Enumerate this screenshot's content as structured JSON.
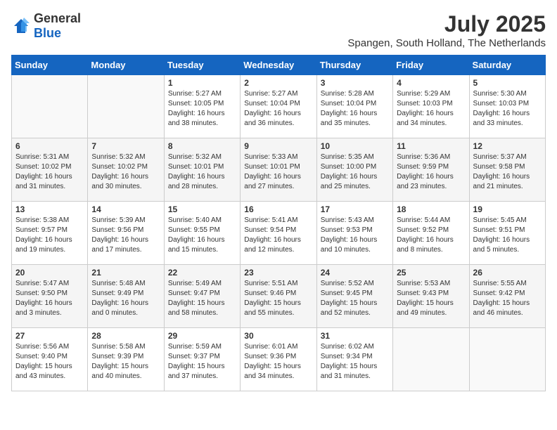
{
  "logo": {
    "general": "General",
    "blue": "Blue"
  },
  "header": {
    "month": "July 2025",
    "location": "Spangen, South Holland, The Netherlands"
  },
  "weekdays": [
    "Sunday",
    "Monday",
    "Tuesday",
    "Wednesday",
    "Thursday",
    "Friday",
    "Saturday"
  ],
  "weeks": [
    [
      {
        "day": "",
        "info": ""
      },
      {
        "day": "",
        "info": ""
      },
      {
        "day": "1",
        "info": "Sunrise: 5:27 AM\nSunset: 10:05 PM\nDaylight: 16 hours\nand 38 minutes."
      },
      {
        "day": "2",
        "info": "Sunrise: 5:27 AM\nSunset: 10:04 PM\nDaylight: 16 hours\nand 36 minutes."
      },
      {
        "day": "3",
        "info": "Sunrise: 5:28 AM\nSunset: 10:04 PM\nDaylight: 16 hours\nand 35 minutes."
      },
      {
        "day": "4",
        "info": "Sunrise: 5:29 AM\nSunset: 10:03 PM\nDaylight: 16 hours\nand 34 minutes."
      },
      {
        "day": "5",
        "info": "Sunrise: 5:30 AM\nSunset: 10:03 PM\nDaylight: 16 hours\nand 33 minutes."
      }
    ],
    [
      {
        "day": "6",
        "info": "Sunrise: 5:31 AM\nSunset: 10:02 PM\nDaylight: 16 hours\nand 31 minutes."
      },
      {
        "day": "7",
        "info": "Sunrise: 5:32 AM\nSunset: 10:02 PM\nDaylight: 16 hours\nand 30 minutes."
      },
      {
        "day": "8",
        "info": "Sunrise: 5:32 AM\nSunset: 10:01 PM\nDaylight: 16 hours\nand 28 minutes."
      },
      {
        "day": "9",
        "info": "Sunrise: 5:33 AM\nSunset: 10:01 PM\nDaylight: 16 hours\nand 27 minutes."
      },
      {
        "day": "10",
        "info": "Sunrise: 5:35 AM\nSunset: 10:00 PM\nDaylight: 16 hours\nand 25 minutes."
      },
      {
        "day": "11",
        "info": "Sunrise: 5:36 AM\nSunset: 9:59 PM\nDaylight: 16 hours\nand 23 minutes."
      },
      {
        "day": "12",
        "info": "Sunrise: 5:37 AM\nSunset: 9:58 PM\nDaylight: 16 hours\nand 21 minutes."
      }
    ],
    [
      {
        "day": "13",
        "info": "Sunrise: 5:38 AM\nSunset: 9:57 PM\nDaylight: 16 hours\nand 19 minutes."
      },
      {
        "day": "14",
        "info": "Sunrise: 5:39 AM\nSunset: 9:56 PM\nDaylight: 16 hours\nand 17 minutes."
      },
      {
        "day": "15",
        "info": "Sunrise: 5:40 AM\nSunset: 9:55 PM\nDaylight: 16 hours\nand 15 minutes."
      },
      {
        "day": "16",
        "info": "Sunrise: 5:41 AM\nSunset: 9:54 PM\nDaylight: 16 hours\nand 12 minutes."
      },
      {
        "day": "17",
        "info": "Sunrise: 5:43 AM\nSunset: 9:53 PM\nDaylight: 16 hours\nand 10 minutes."
      },
      {
        "day": "18",
        "info": "Sunrise: 5:44 AM\nSunset: 9:52 PM\nDaylight: 16 hours\nand 8 minutes."
      },
      {
        "day": "19",
        "info": "Sunrise: 5:45 AM\nSunset: 9:51 PM\nDaylight: 16 hours\nand 5 minutes."
      }
    ],
    [
      {
        "day": "20",
        "info": "Sunrise: 5:47 AM\nSunset: 9:50 PM\nDaylight: 16 hours\nand 3 minutes."
      },
      {
        "day": "21",
        "info": "Sunrise: 5:48 AM\nSunset: 9:49 PM\nDaylight: 16 hours\nand 0 minutes."
      },
      {
        "day": "22",
        "info": "Sunrise: 5:49 AM\nSunset: 9:47 PM\nDaylight: 15 hours\nand 58 minutes."
      },
      {
        "day": "23",
        "info": "Sunrise: 5:51 AM\nSunset: 9:46 PM\nDaylight: 15 hours\nand 55 minutes."
      },
      {
        "day": "24",
        "info": "Sunrise: 5:52 AM\nSunset: 9:45 PM\nDaylight: 15 hours\nand 52 minutes."
      },
      {
        "day": "25",
        "info": "Sunrise: 5:53 AM\nSunset: 9:43 PM\nDaylight: 15 hours\nand 49 minutes."
      },
      {
        "day": "26",
        "info": "Sunrise: 5:55 AM\nSunset: 9:42 PM\nDaylight: 15 hours\nand 46 minutes."
      }
    ],
    [
      {
        "day": "27",
        "info": "Sunrise: 5:56 AM\nSunset: 9:40 PM\nDaylight: 15 hours\nand 43 minutes."
      },
      {
        "day": "28",
        "info": "Sunrise: 5:58 AM\nSunset: 9:39 PM\nDaylight: 15 hours\nand 40 minutes."
      },
      {
        "day": "29",
        "info": "Sunrise: 5:59 AM\nSunset: 9:37 PM\nDaylight: 15 hours\nand 37 minutes."
      },
      {
        "day": "30",
        "info": "Sunrise: 6:01 AM\nSunset: 9:36 PM\nDaylight: 15 hours\nand 34 minutes."
      },
      {
        "day": "31",
        "info": "Sunrise: 6:02 AM\nSunset: 9:34 PM\nDaylight: 15 hours\nand 31 minutes."
      },
      {
        "day": "",
        "info": ""
      },
      {
        "day": "",
        "info": ""
      }
    ]
  ]
}
